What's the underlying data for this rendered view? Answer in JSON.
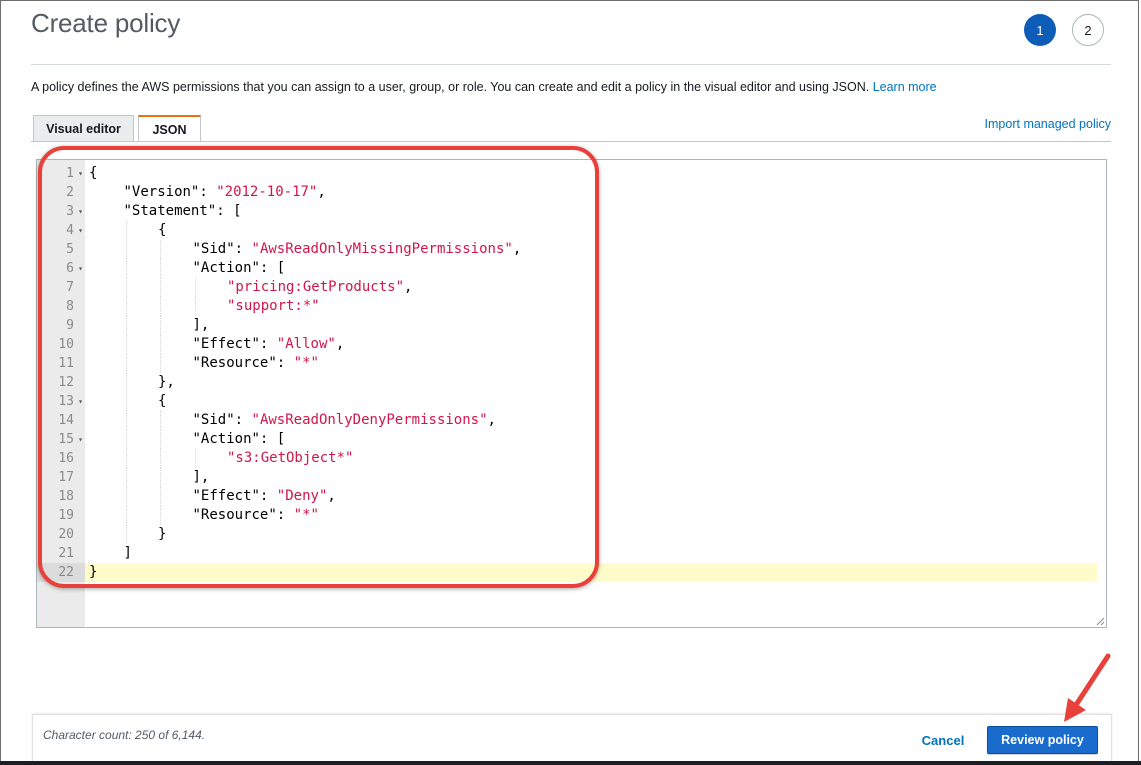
{
  "page": {
    "title": "Create policy",
    "steps": [
      "1",
      "2"
    ],
    "active_step": "1",
    "description": "A policy defines the AWS permissions that you can assign to a user, group, or role. You can create and edit a policy in the visual editor and using JSON.",
    "learn_more": "Learn more"
  },
  "tabs": [
    {
      "label": "Visual editor",
      "active": false
    },
    {
      "label": "JSON",
      "active": true
    }
  ],
  "import_link": "Import managed policy",
  "editor": {
    "lines": [
      {
        "n": "1",
        "fold": true,
        "indent": 0,
        "parts": [
          [
            "p",
            "{"
          ]
        ]
      },
      {
        "n": "2",
        "fold": false,
        "indent": 1,
        "parts": [
          [
            "p",
            "\"Version\": "
          ],
          [
            "s",
            "\"2012-10-17\""
          ],
          [
            "p",
            ","
          ]
        ]
      },
      {
        "n": "3",
        "fold": true,
        "indent": 1,
        "parts": [
          [
            "p",
            "\"Statement\": ["
          ]
        ]
      },
      {
        "n": "4",
        "fold": true,
        "indent": 2,
        "parts": [
          [
            "p",
            "{"
          ]
        ]
      },
      {
        "n": "5",
        "fold": false,
        "indent": 3,
        "parts": [
          [
            "p",
            "\"Sid\": "
          ],
          [
            "s",
            "\"AwsReadOnlyMissingPermissions\""
          ],
          [
            "p",
            ","
          ]
        ]
      },
      {
        "n": "6",
        "fold": true,
        "indent": 3,
        "parts": [
          [
            "p",
            "\"Action\": ["
          ]
        ]
      },
      {
        "n": "7",
        "fold": false,
        "indent": 4,
        "parts": [
          [
            "s",
            "\"pricing:GetProducts\""
          ],
          [
            "p",
            ","
          ]
        ]
      },
      {
        "n": "8",
        "fold": false,
        "indent": 4,
        "parts": [
          [
            "s",
            "\"support:*\""
          ]
        ]
      },
      {
        "n": "9",
        "fold": false,
        "indent": 3,
        "parts": [
          [
            "p",
            "],"
          ]
        ]
      },
      {
        "n": "10",
        "fold": false,
        "indent": 3,
        "parts": [
          [
            "p",
            "\"Effect\": "
          ],
          [
            "s",
            "\"Allow\""
          ],
          [
            "p",
            ","
          ]
        ]
      },
      {
        "n": "11",
        "fold": false,
        "indent": 3,
        "parts": [
          [
            "p",
            "\"Resource\": "
          ],
          [
            "s",
            "\"*\""
          ]
        ]
      },
      {
        "n": "12",
        "fold": false,
        "indent": 2,
        "parts": [
          [
            "p",
            "},"
          ]
        ]
      },
      {
        "n": "13",
        "fold": true,
        "indent": 2,
        "parts": [
          [
            "p",
            "{"
          ]
        ]
      },
      {
        "n": "14",
        "fold": false,
        "indent": 3,
        "parts": [
          [
            "p",
            "\"Sid\": "
          ],
          [
            "s",
            "\"AwsReadOnlyDenyPermissions\""
          ],
          [
            "p",
            ","
          ]
        ]
      },
      {
        "n": "15",
        "fold": true,
        "indent": 3,
        "parts": [
          [
            "p",
            "\"Action\": ["
          ]
        ]
      },
      {
        "n": "16",
        "fold": false,
        "indent": 4,
        "parts": [
          [
            "s",
            "\"s3:GetObject*\""
          ]
        ]
      },
      {
        "n": "17",
        "fold": false,
        "indent": 3,
        "parts": [
          [
            "p",
            "],"
          ]
        ]
      },
      {
        "n": "18",
        "fold": false,
        "indent": 3,
        "parts": [
          [
            "p",
            "\"Effect\": "
          ],
          [
            "s",
            "\"Deny\""
          ],
          [
            "p",
            ","
          ]
        ]
      },
      {
        "n": "19",
        "fold": false,
        "indent": 3,
        "parts": [
          [
            "p",
            "\"Resource\": "
          ],
          [
            "s",
            "\"*\""
          ]
        ]
      },
      {
        "n": "20",
        "fold": false,
        "indent": 2,
        "parts": [
          [
            "p",
            "}"
          ]
        ]
      },
      {
        "n": "21",
        "fold": false,
        "indent": 1,
        "parts": [
          [
            "p",
            "]"
          ]
        ]
      },
      {
        "n": "22",
        "fold": false,
        "indent": 0,
        "parts": [
          [
            "p",
            "}"
          ]
        ]
      }
    ],
    "active_line": "22",
    "string_color": "#d0164a"
  },
  "footer": {
    "char_count": "Character count: 250 of 6,144.",
    "cancel_label": "Cancel",
    "review_label": "Review policy"
  },
  "colors": {
    "primary_button": "#1a6ccc",
    "link": "#0073bb",
    "active_tab_accent": "#ec7211",
    "callout": "#e8403a"
  },
  "icons": {
    "fold": "fold-triangle-icon",
    "resize": "resize-grip-icon",
    "annotation_arrow": "arrow-icon"
  }
}
